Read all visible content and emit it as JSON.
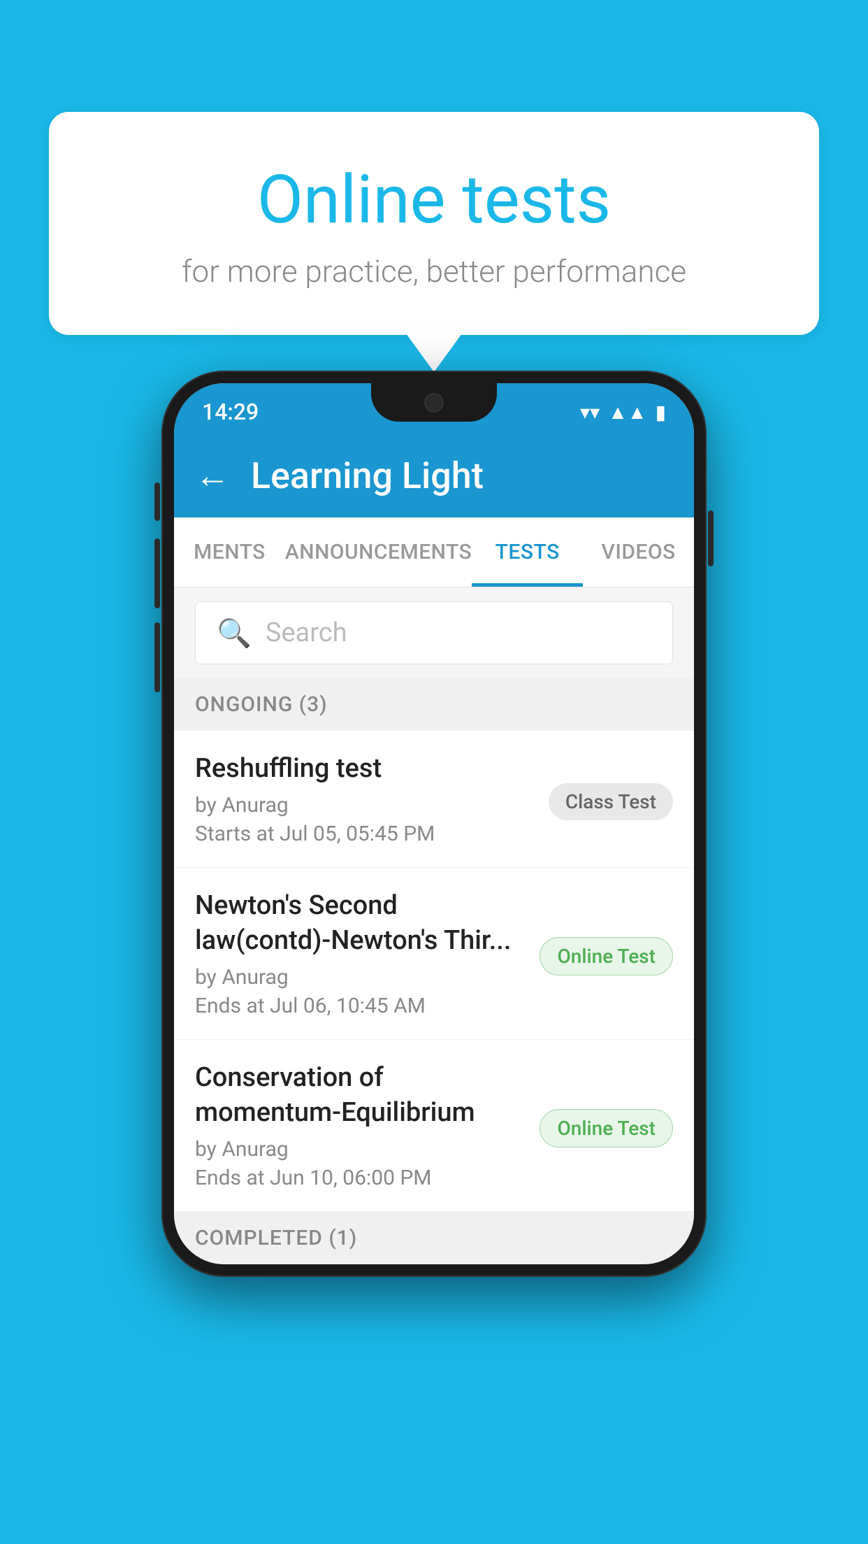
{
  "background_color": "#1ab8e8",
  "speech_bubble": {
    "title": "Online tests",
    "subtitle": "for more practice, better performance"
  },
  "phone": {
    "status_bar": {
      "time": "14:29",
      "icons": [
        "wifi",
        "signal",
        "battery"
      ]
    },
    "app_bar": {
      "title": "Learning Light",
      "back_label": "←"
    },
    "tabs": [
      {
        "label": "MENTS",
        "active": false
      },
      {
        "label": "ANNOUNCEMENTS",
        "active": false
      },
      {
        "label": "TESTS",
        "active": true
      },
      {
        "label": "VIDEOS",
        "active": false
      }
    ],
    "search": {
      "placeholder": "Search"
    },
    "ongoing_section": {
      "label": "ONGOING (3)"
    },
    "tests": [
      {
        "name": "Reshuffling test",
        "author": "by Anurag",
        "time_label": "Starts at",
        "time": "Jul 05, 05:45 PM",
        "badge": "Class Test",
        "badge_type": "class"
      },
      {
        "name": "Newton's Second law(contd)-Newton's Thir...",
        "author": "by Anurag",
        "time_label": "Ends at",
        "time": "Jul 06, 10:45 AM",
        "badge": "Online Test",
        "badge_type": "online"
      },
      {
        "name": "Conservation of momentum-Equilibrium",
        "author": "by Anurag",
        "time_label": "Ends at",
        "time": "Jun 10, 06:00 PM",
        "badge": "Online Test",
        "badge_type": "online"
      }
    ],
    "completed_section": {
      "label": "COMPLETED (1)"
    }
  }
}
